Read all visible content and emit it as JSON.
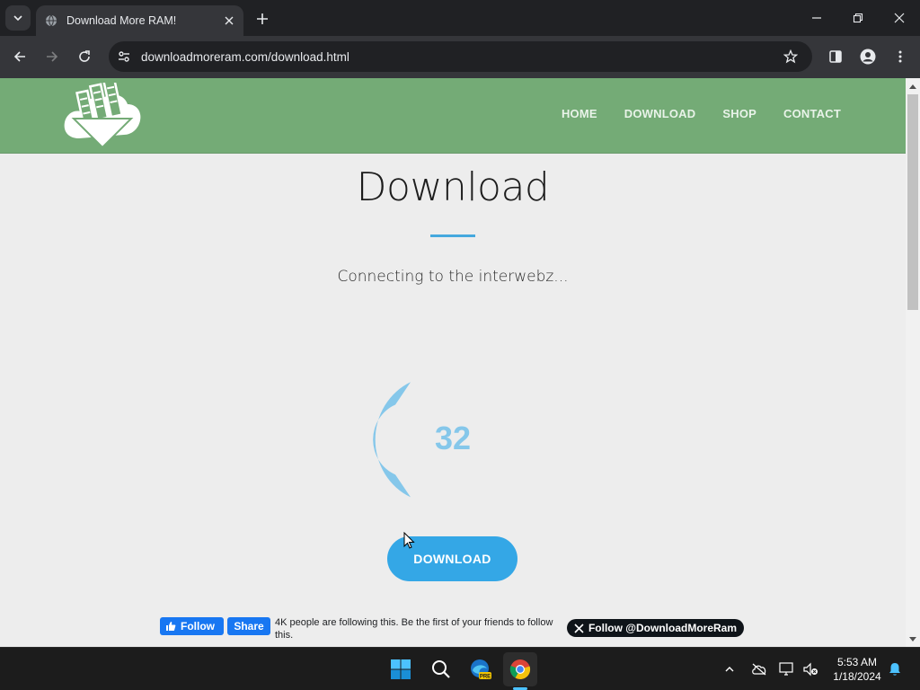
{
  "browser": {
    "tab_title": "Download More RAM!",
    "url": "downloadmoreram.com/download.html"
  },
  "site": {
    "nav": [
      "HOME",
      "DOWNLOAD",
      "SHOP",
      "CONTACT"
    ],
    "page_title": "Download",
    "status_text": "Connecting to the interwebz...",
    "progress_value": "32",
    "download_button": "DOWNLOAD",
    "social": {
      "fb_follow": "Follow",
      "fb_share": "Share",
      "fb_text": "4K people are following this. Be the first of your friends to follow this.",
      "x_follow": "Follow @DownloadMoreRam"
    }
  },
  "taskbar": {
    "time": "5:53 AM",
    "date": "1/18/2024"
  },
  "colors": {
    "header_green": "#74ab76",
    "accent_blue": "#34a7e6",
    "progress_blue": "#85c7ea"
  }
}
